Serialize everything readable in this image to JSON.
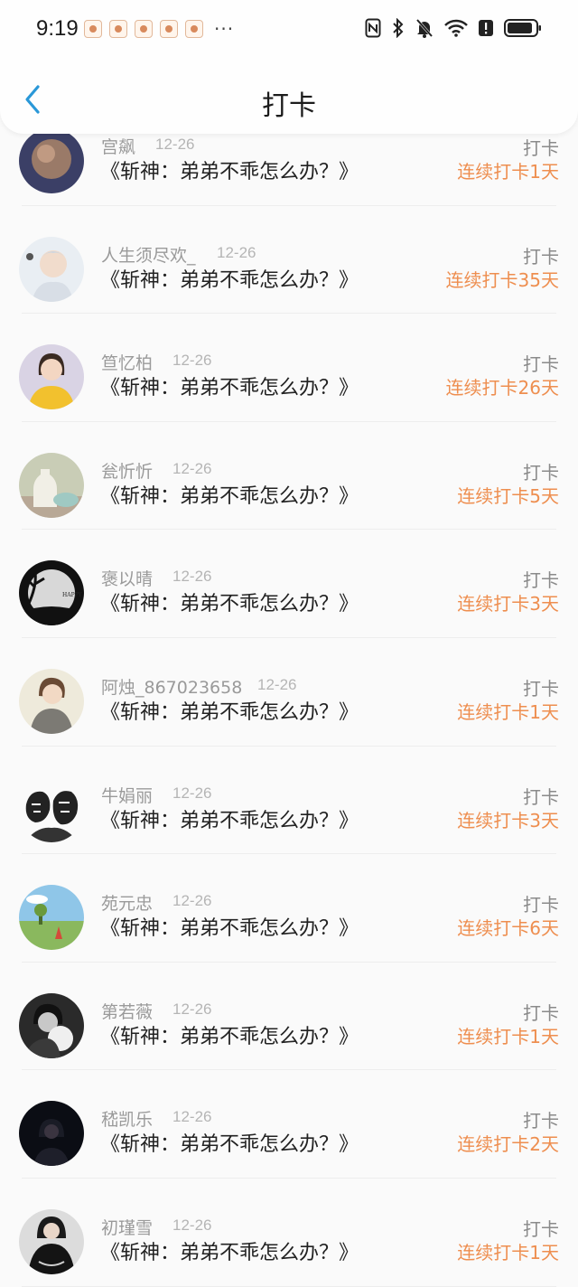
{
  "status_bar": {
    "time": "9:19",
    "more": "···",
    "icons": [
      "nfc-icon",
      "bluetooth-icon",
      "mute-icon",
      "wifi-icon",
      "alert-icon",
      "battery-icon"
    ]
  },
  "header": {
    "back_icon": "chevron-left-icon",
    "title": "打卡"
  },
  "colors": {
    "streak": "#ee8e4f",
    "back": "#2a98d8",
    "name": "#9a9a9a"
  },
  "list": [
    {
      "name": "宫飙",
      "date": "12-26",
      "tag": "打卡",
      "book": "《斩神：弟弟不乖怎么办？》",
      "streak": "连续打卡1天"
    },
    {
      "name": "人生须尽欢_",
      "date": "12-26",
      "tag": "打卡",
      "book": "《斩神：弟弟不乖怎么办？》",
      "streak": "连续打卡35天"
    },
    {
      "name": "笪忆柏",
      "date": "12-26",
      "tag": "打卡",
      "book": "《斩神：弟弟不乖怎么办？》",
      "streak": "连续打卡26天"
    },
    {
      "name": "瓮忻忻",
      "date": "12-26",
      "tag": "打卡",
      "book": "《斩神：弟弟不乖怎么办？》",
      "streak": "连续打卡5天"
    },
    {
      "name": "褒以晴",
      "date": "12-26",
      "tag": "打卡",
      "book": "《斩神：弟弟不乖怎么办？》",
      "streak": "连续打卡3天"
    },
    {
      "name": "阿烛_867023658",
      "date": "12-26",
      "tag": "打卡",
      "book": "《斩神：弟弟不乖怎么办？》",
      "streak": "连续打卡1天"
    },
    {
      "name": "牛娟丽",
      "date": "12-26",
      "tag": "打卡",
      "book": "《斩神：弟弟不乖怎么办？》",
      "streak": "连续打卡3天"
    },
    {
      "name": "苑元忠",
      "date": "12-26",
      "tag": "打卡",
      "book": "《斩神：弟弟不乖怎么办？》",
      "streak": "连续打卡6天"
    },
    {
      "name": "第若薇",
      "date": "12-26",
      "tag": "打卡",
      "book": "《斩神：弟弟不乖怎么办？》",
      "streak": "连续打卡1天"
    },
    {
      "name": "嵇凯乐",
      "date": "12-26",
      "tag": "打卡",
      "book": "《斩神：弟弟不乖怎么办？》",
      "streak": "连续打卡2天"
    },
    {
      "name": "初瑾雪",
      "date": "12-26",
      "tag": "打卡",
      "book": "《斩神：弟弟不乖怎么办？》",
      "streak": "连续打卡1天"
    }
  ]
}
